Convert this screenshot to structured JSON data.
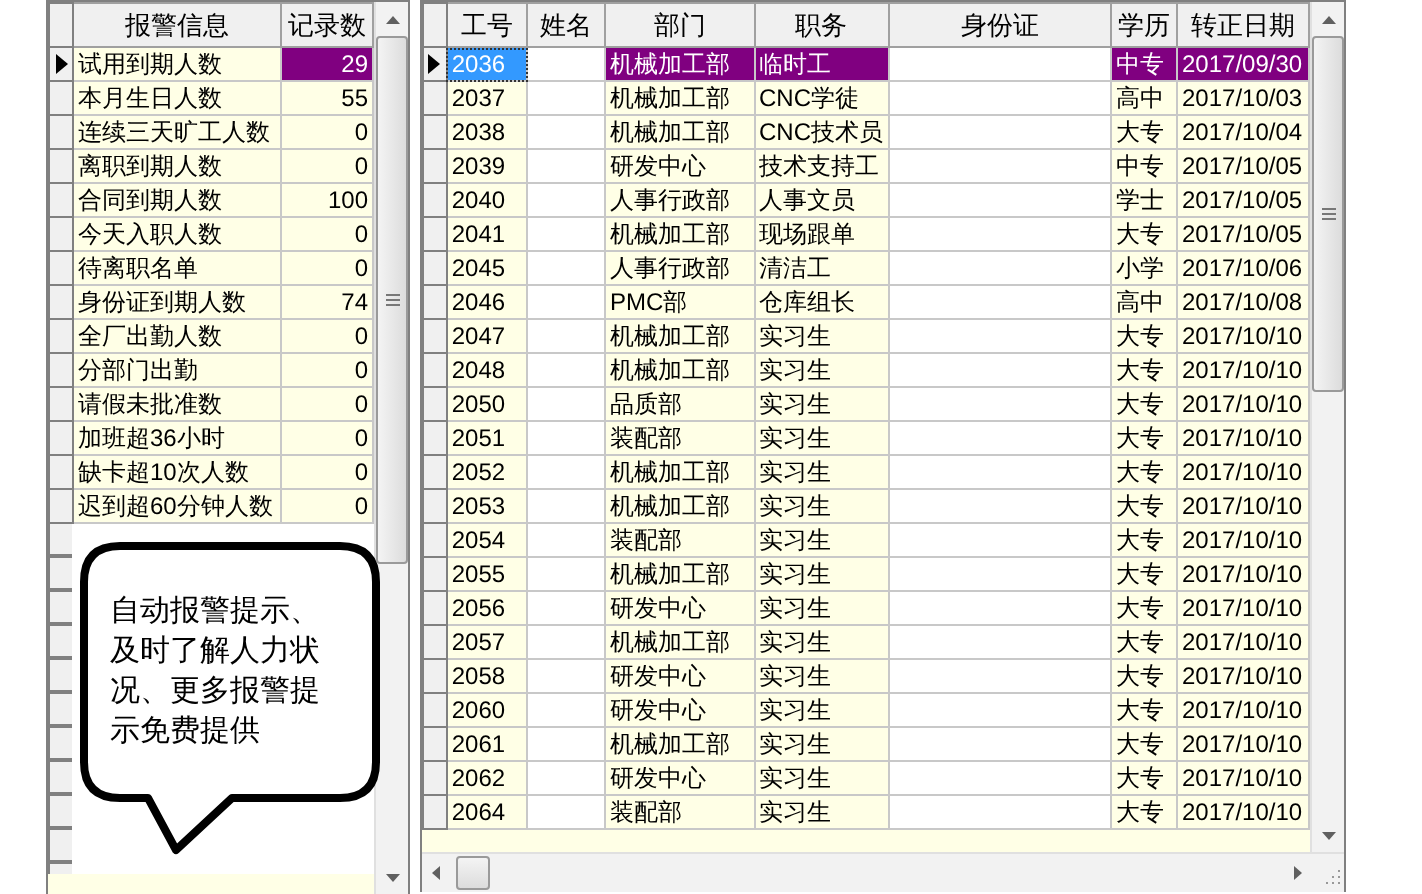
{
  "alerts": {
    "columns": [
      "报警信息",
      "记录数"
    ],
    "rows": [
      {
        "label": "试用到期人数",
        "count": "29",
        "selected": true
      },
      {
        "label": "本月生日人数",
        "count": "55",
        "selected": false
      },
      {
        "label": "连续三天旷工人数",
        "count": "0",
        "selected": false
      },
      {
        "label": "离职到期人数",
        "count": "0",
        "selected": false
      },
      {
        "label": "合同到期人数",
        "count": "100",
        "selected": false
      },
      {
        "label": "今天入职人数",
        "count": "0",
        "selected": false
      },
      {
        "label": "待离职名单",
        "count": "0",
        "selected": false
      },
      {
        "label": "身份证到期人数",
        "count": "74",
        "selected": false
      },
      {
        "label": "全厂出勤人数",
        "count": "0",
        "selected": false
      },
      {
        "label": "分部门出勤",
        "count": "0",
        "selected": false
      },
      {
        "label": "请假未批准数",
        "count": "0",
        "selected": false
      },
      {
        "label": "加班超36小时",
        "count": "0",
        "selected": false
      },
      {
        "label": "缺卡超10次人数",
        "count": "0",
        "selected": false
      },
      {
        "label": "迟到超60分钟人数",
        "count": "0",
        "selected": false
      }
    ]
  },
  "bubble": {
    "text": "自动报警提示、及时了解人力状况、更多报警提示免费提供"
  },
  "employees": {
    "columns": [
      "工号",
      "姓名",
      "部门",
      "职务",
      "身份证",
      "学历",
      "转正日期"
    ],
    "rows": [
      {
        "id": "2036",
        "department": "机械加工部",
        "position": "临时工",
        "education": "中专",
        "confirm_date": "2017/09/30",
        "selected": true
      },
      {
        "id": "2037",
        "department": "机械加工部",
        "position": "CNC学徒",
        "education": "高中",
        "confirm_date": "2017/10/03",
        "selected": false
      },
      {
        "id": "2038",
        "department": "机械加工部",
        "position": "CNC技术员",
        "education": "大专",
        "confirm_date": "2017/10/04",
        "selected": false
      },
      {
        "id": "2039",
        "department": "研发中心",
        "position": "技术支持工",
        "education": "中专",
        "confirm_date": "2017/10/05",
        "selected": false
      },
      {
        "id": "2040",
        "department": "人事行政部",
        "position": "人事文员",
        "education": "学士",
        "confirm_date": "2017/10/05",
        "selected": false
      },
      {
        "id": "2041",
        "department": "机械加工部",
        "position": "现场跟单",
        "education": "大专",
        "confirm_date": "2017/10/05",
        "selected": false
      },
      {
        "id": "2045",
        "department": "人事行政部",
        "position": "清洁工",
        "education": "小学",
        "confirm_date": "2017/10/06",
        "selected": false
      },
      {
        "id": "2046",
        "department": "PMC部",
        "position": "仓库组长",
        "education": "高中",
        "confirm_date": "2017/10/08",
        "selected": false
      },
      {
        "id": "2047",
        "department": "机械加工部",
        "position": "实习生",
        "education": "大专",
        "confirm_date": "2017/10/10",
        "selected": false
      },
      {
        "id": "2048",
        "department": "机械加工部",
        "position": "实习生",
        "education": "大专",
        "confirm_date": "2017/10/10",
        "selected": false
      },
      {
        "id": "2050",
        "department": "品质部",
        "position": "实习生",
        "education": "大专",
        "confirm_date": "2017/10/10",
        "selected": false
      },
      {
        "id": "2051",
        "department": "装配部",
        "position": "实习生",
        "education": "大专",
        "confirm_date": "2017/10/10",
        "selected": false
      },
      {
        "id": "2052",
        "department": "机械加工部",
        "position": "实习生",
        "education": "大专",
        "confirm_date": "2017/10/10",
        "selected": false
      },
      {
        "id": "2053",
        "department": "机械加工部",
        "position": "实习生",
        "education": "大专",
        "confirm_date": "2017/10/10",
        "selected": false
      },
      {
        "id": "2054",
        "department": "装配部",
        "position": "实习生",
        "education": "大专",
        "confirm_date": "2017/10/10",
        "selected": false
      },
      {
        "id": "2055",
        "department": "机械加工部",
        "position": "实习生",
        "education": "大专",
        "confirm_date": "2017/10/10",
        "selected": false
      },
      {
        "id": "2056",
        "department": "研发中心",
        "position": "实习生",
        "education": "大专",
        "confirm_date": "2017/10/10",
        "selected": false
      },
      {
        "id": "2057",
        "department": "机械加工部",
        "position": "实习生",
        "education": "大专",
        "confirm_date": "2017/10/10",
        "selected": false
      },
      {
        "id": "2058",
        "department": "研发中心",
        "position": "实习生",
        "education": "大专",
        "confirm_date": "2017/10/10",
        "selected": false
      },
      {
        "id": "2060",
        "department": "研发中心",
        "position": "实习生",
        "education": "大专",
        "confirm_date": "2017/10/10",
        "selected": false
      },
      {
        "id": "2061",
        "department": "机械加工部",
        "position": "实习生",
        "education": "大专",
        "confirm_date": "2017/10/10",
        "selected": false
      },
      {
        "id": "2062",
        "department": "研发中心",
        "position": "实习生",
        "education": "大专",
        "confirm_date": "2017/10/10",
        "selected": false
      },
      {
        "id": "2064",
        "department": "装配部",
        "position": "实习生",
        "education": "大专",
        "confirm_date": "2017/10/10",
        "selected": false
      }
    ]
  }
}
